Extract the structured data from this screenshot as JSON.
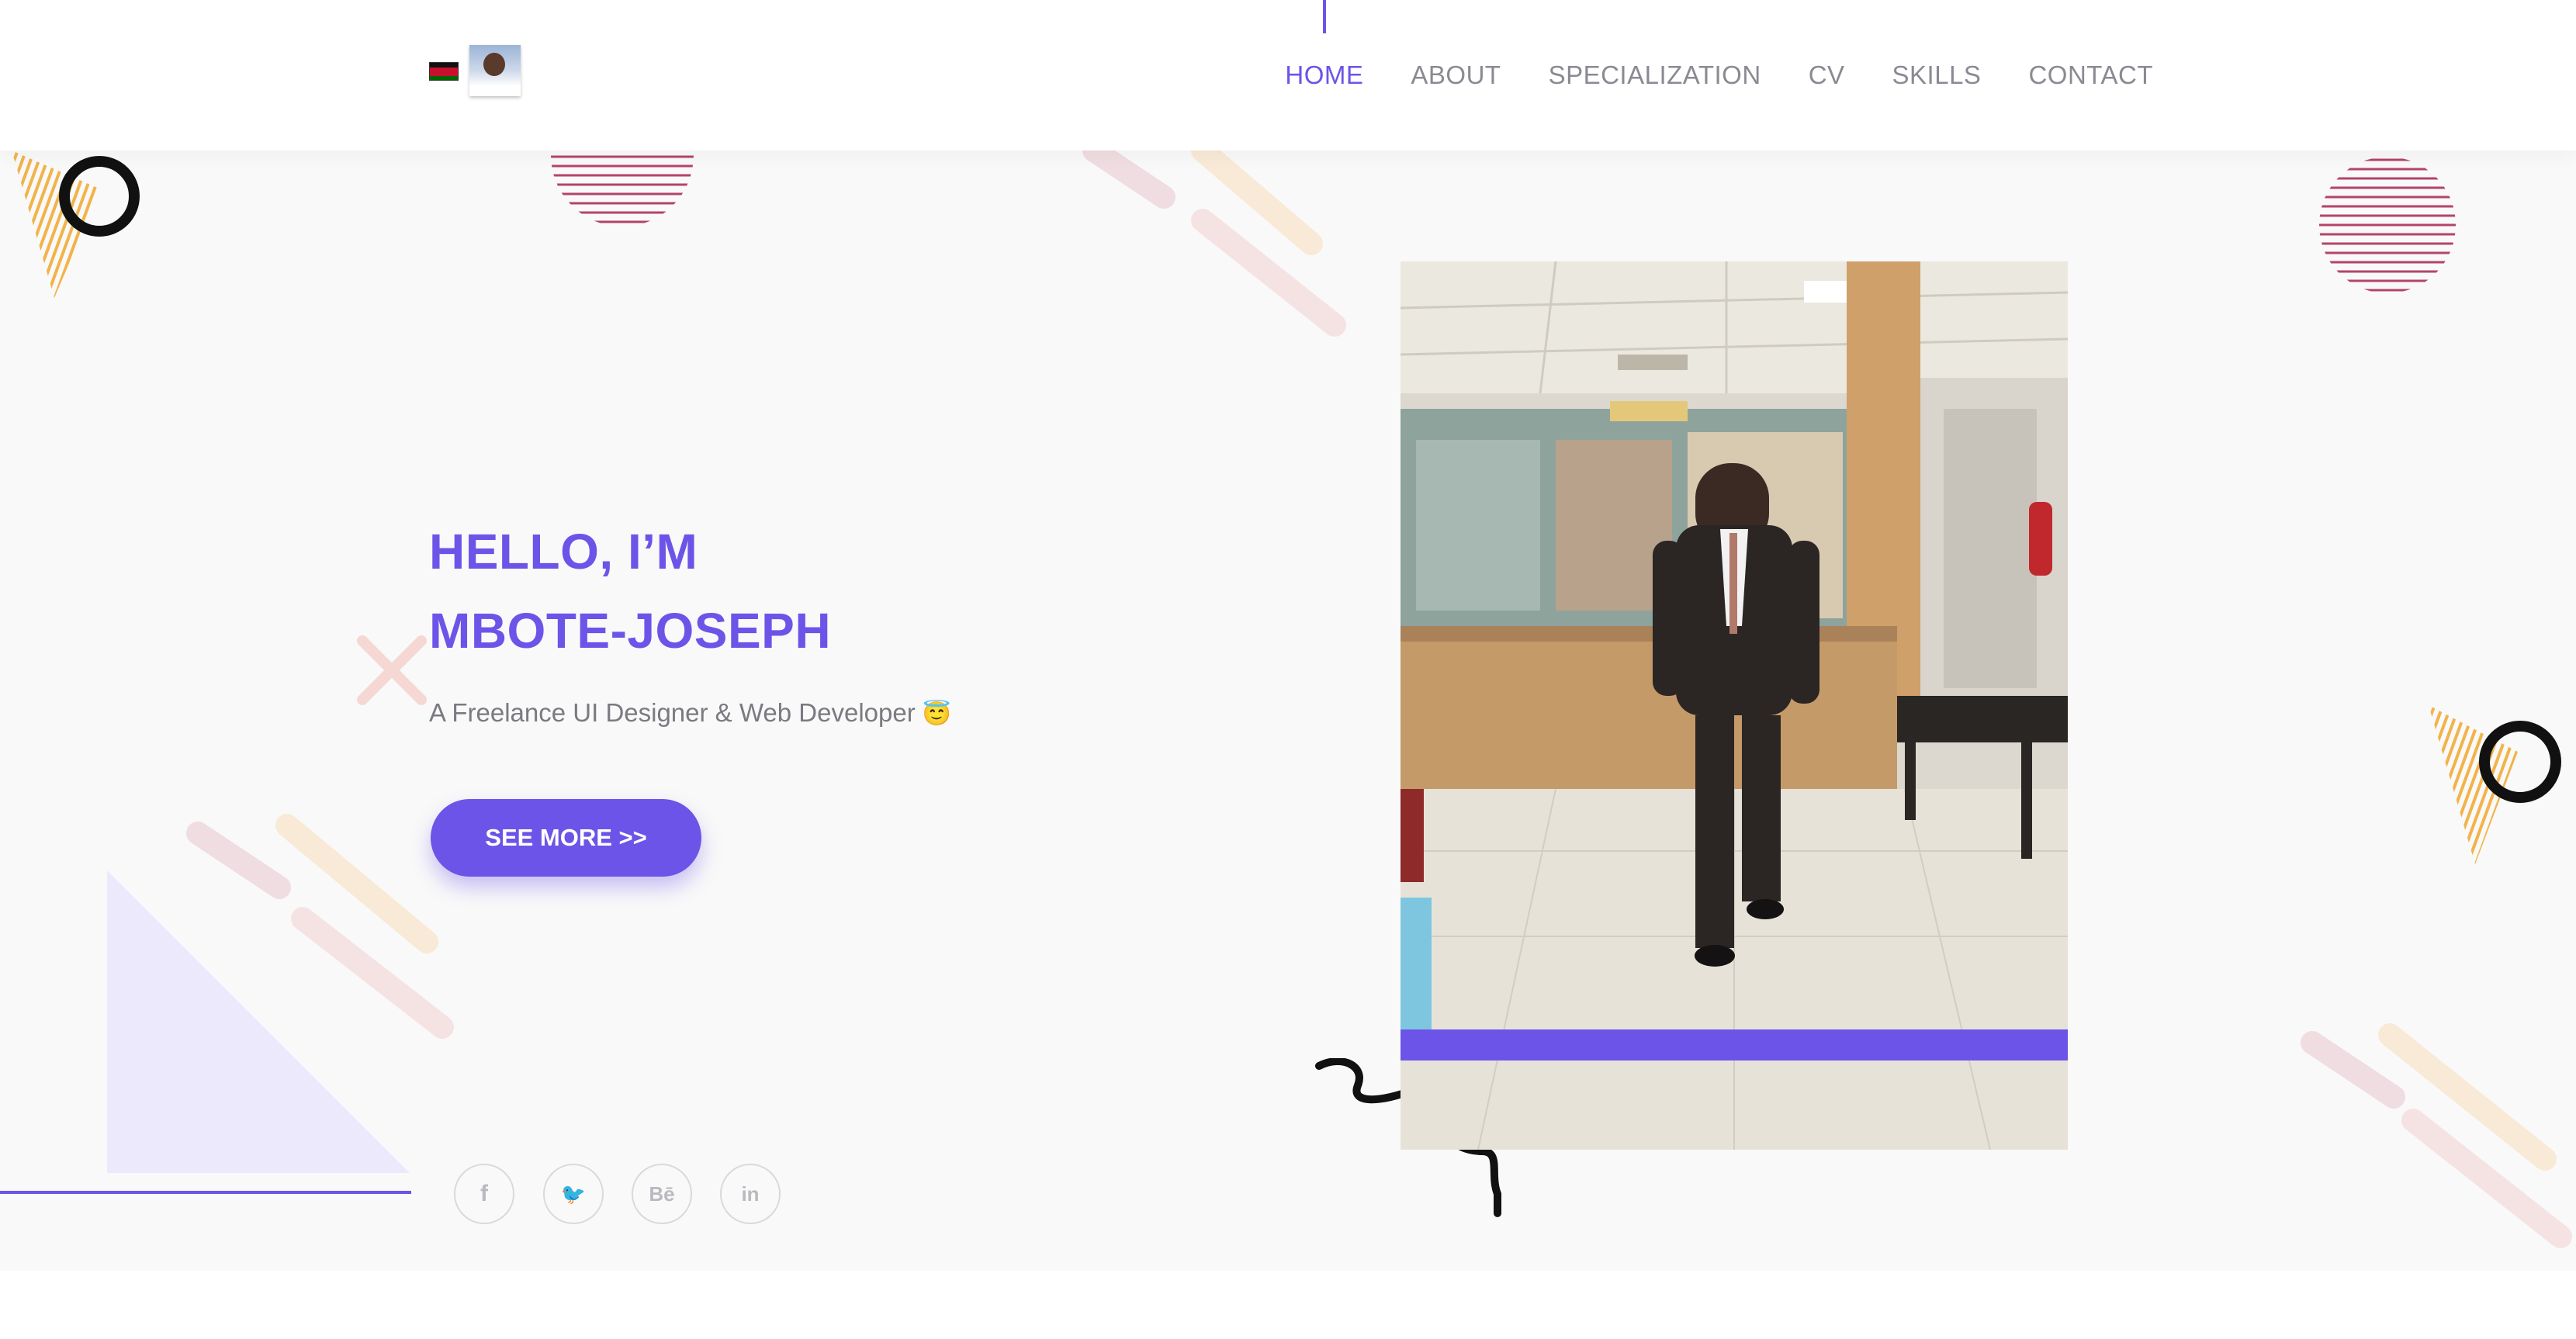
{
  "header": {
    "flag_icon": "kenya-flag-icon",
    "avatar_icon": "profile-avatar",
    "nav": [
      {
        "label": "HOME",
        "active": true
      },
      {
        "label": "ABOUT",
        "active": false
      },
      {
        "label": "SPECIALIZATION",
        "active": false
      },
      {
        "label": "CV",
        "active": false
      },
      {
        "label": "SKILLS",
        "active": false
      },
      {
        "label": "CONTACT",
        "active": false
      }
    ]
  },
  "hero": {
    "greeting": "HELLO, I’M",
    "name": "MBOTE-JOSEPH",
    "tagline": "A Freelance UI Designer & Web Developer",
    "tagline_emoji": "😇",
    "cta_label": "SEE MORE >>"
  },
  "social": [
    {
      "icon": "facebook-icon",
      "glyph": "f"
    },
    {
      "icon": "twitter-icon",
      "glyph": "🐦"
    },
    {
      "icon": "behance-icon",
      "glyph": "Bē"
    },
    {
      "icon": "linkedin-icon",
      "glyph": "in"
    }
  ],
  "colors": {
    "accent": "#6c54e8",
    "nav_text": "#8a8a93",
    "hero_bg": "#f9f9f9",
    "deco_orange": "#f2b34a",
    "deco_pink": "#b4446a"
  }
}
